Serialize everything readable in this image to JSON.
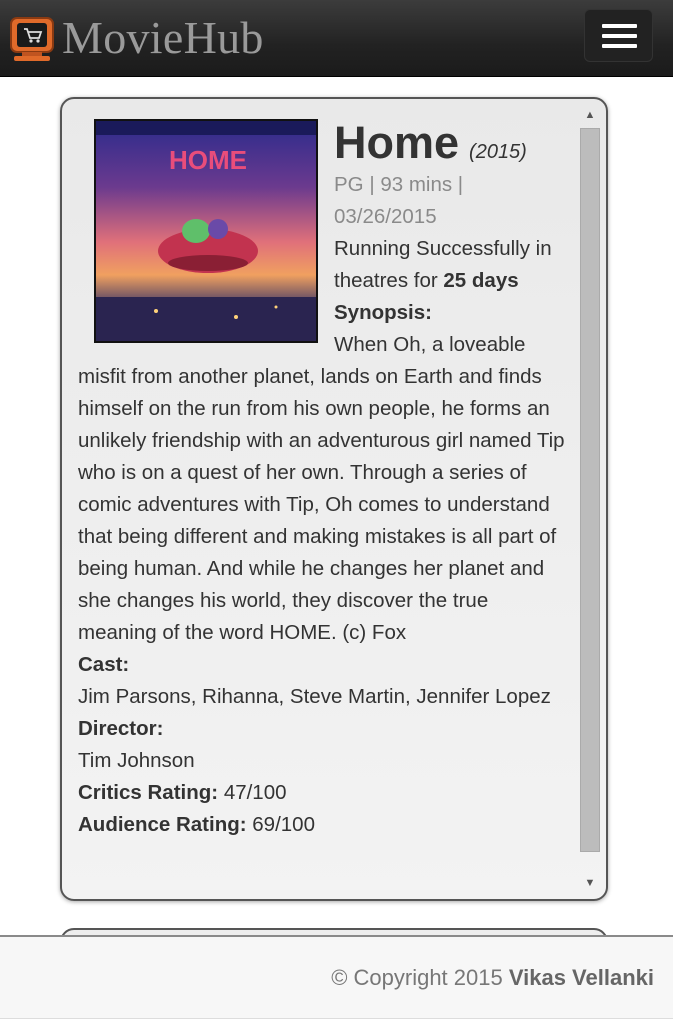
{
  "header": {
    "brand": "MovieHub",
    "logo_icon": "tv-cart-icon",
    "menu_icon": "hamburger-menu-icon"
  },
  "movie": {
    "title": "Home",
    "year": "(2015)",
    "meta_line1": "PG | 93 mins |",
    "meta_line2": "03/26/2015",
    "running_prefix": "Running Successfully in theatres for",
    "running_days": "25 days",
    "synopsis_label": "Synopsis:",
    "synopsis": "When Oh, a loveable misfit from another planet, lands on Earth and finds himself on the run from his own people, he forms an unlikely friendship with an adventurous girl named Tip who is on a quest of her own. Through a series of comic adventures with Tip, Oh comes to understand that being different and making mistakes is all part of being human. And while he changes her planet and she changes his world, they discover the true meaning of the word HOME. (c) Fox",
    "cast_label": "Cast:",
    "cast": "Jim Parsons, Rihanna, Steve Martin, Jennifer Lopez",
    "director_label": "Director:",
    "director": "Tim Johnson",
    "critics_label": "Critics Rating:",
    "critics_value": "47/100",
    "audience_label": "Audience Rating:",
    "audience_value": "69/100",
    "poster_text": "HOME"
  },
  "footer": {
    "copyright": "© Copyright 2015",
    "owner": "Vikas Vellanki"
  },
  "colors": {
    "navbar": "#222222",
    "brand_text": "#9a9a9a",
    "logo_accent": "#e06a2a"
  }
}
